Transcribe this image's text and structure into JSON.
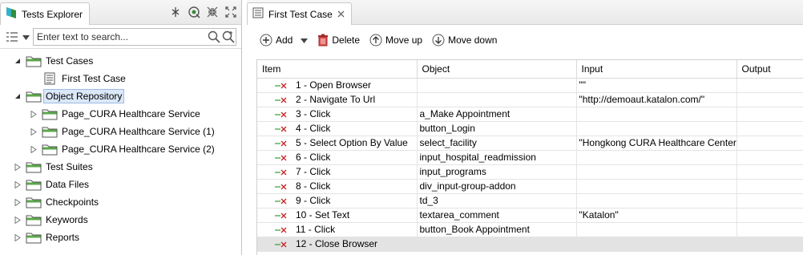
{
  "explorer": {
    "title": "Tests Explorer",
    "search_placeholder": "Enter text to search...",
    "tree": [
      {
        "label": "Test Cases",
        "level": 0,
        "expanded": true,
        "icon": "folder-icon"
      },
      {
        "label": "First Test Case",
        "level": 1,
        "icon": "test-case-icon"
      },
      {
        "label": "Object Repository",
        "level": 0,
        "expanded": true,
        "selected": true,
        "icon": "folder-icon"
      },
      {
        "label": "Page_CURA Healthcare Service",
        "level": 1,
        "icon": "folder-icon"
      },
      {
        "label": "Page_CURA Healthcare Service (1)",
        "level": 1,
        "icon": "folder-icon"
      },
      {
        "label": "Page_CURA Healthcare Service (2)",
        "level": 1,
        "icon": "folder-icon"
      },
      {
        "label": "Test Suites",
        "level": 0,
        "icon": "folder-icon"
      },
      {
        "label": "Data Files",
        "level": 0,
        "icon": "folder-icon"
      },
      {
        "label": "Checkpoints",
        "level": 0,
        "icon": "folder-icon"
      },
      {
        "label": "Keywords",
        "level": 0,
        "icon": "folder-icon"
      },
      {
        "label": "Reports",
        "level": 0,
        "icon": "folder-icon"
      }
    ]
  },
  "editor": {
    "tab_title": "First Test Case",
    "toolbar": {
      "add": "Add",
      "delete": "Delete",
      "move_up": "Move up",
      "move_down": "Move down"
    },
    "columns": [
      "Item",
      "Object",
      "Input",
      "Output"
    ],
    "rows": [
      {
        "item": "1 - Open Browser",
        "object": "",
        "input": "\"\"",
        "output": ""
      },
      {
        "item": "2 - Navigate To Url",
        "object": "",
        "input": "\"http://demoaut.katalon.com/\"",
        "output": ""
      },
      {
        "item": "3 - Click",
        "object": "a_Make Appointment",
        "input": "",
        "output": ""
      },
      {
        "item": "4 - Click",
        "object": "button_Login",
        "input": "",
        "output": ""
      },
      {
        "item": "5 - Select Option By Value",
        "object": "select_facility",
        "input": "\"Hongkong CURA Healthcare Center",
        "output": ""
      },
      {
        "item": "6 - Click",
        "object": "input_hospital_readmission",
        "input": "",
        "output": ""
      },
      {
        "item": "7 - Click",
        "object": "input_programs",
        "input": "",
        "output": ""
      },
      {
        "item": "8 - Click",
        "object": "div_input-group-addon",
        "input": "",
        "output": ""
      },
      {
        "item": "9 - Click",
        "object": "td_3",
        "input": "",
        "output": ""
      },
      {
        "item": "10 - Set Text",
        "object": "textarea_comment",
        "input": "\"Katalon\"",
        "output": ""
      },
      {
        "item": "11 - Click",
        "object": "button_Book Appointment",
        "input": "",
        "output": ""
      },
      {
        "item": "12 - Close Browser",
        "object": "",
        "input": "",
        "output": "",
        "selected": true
      }
    ]
  },
  "colors": {
    "folder_green": "#5aa84a",
    "step_red": "#cc2222",
    "step_green": "#3a9a3a",
    "selection": "#dbe8f8"
  }
}
